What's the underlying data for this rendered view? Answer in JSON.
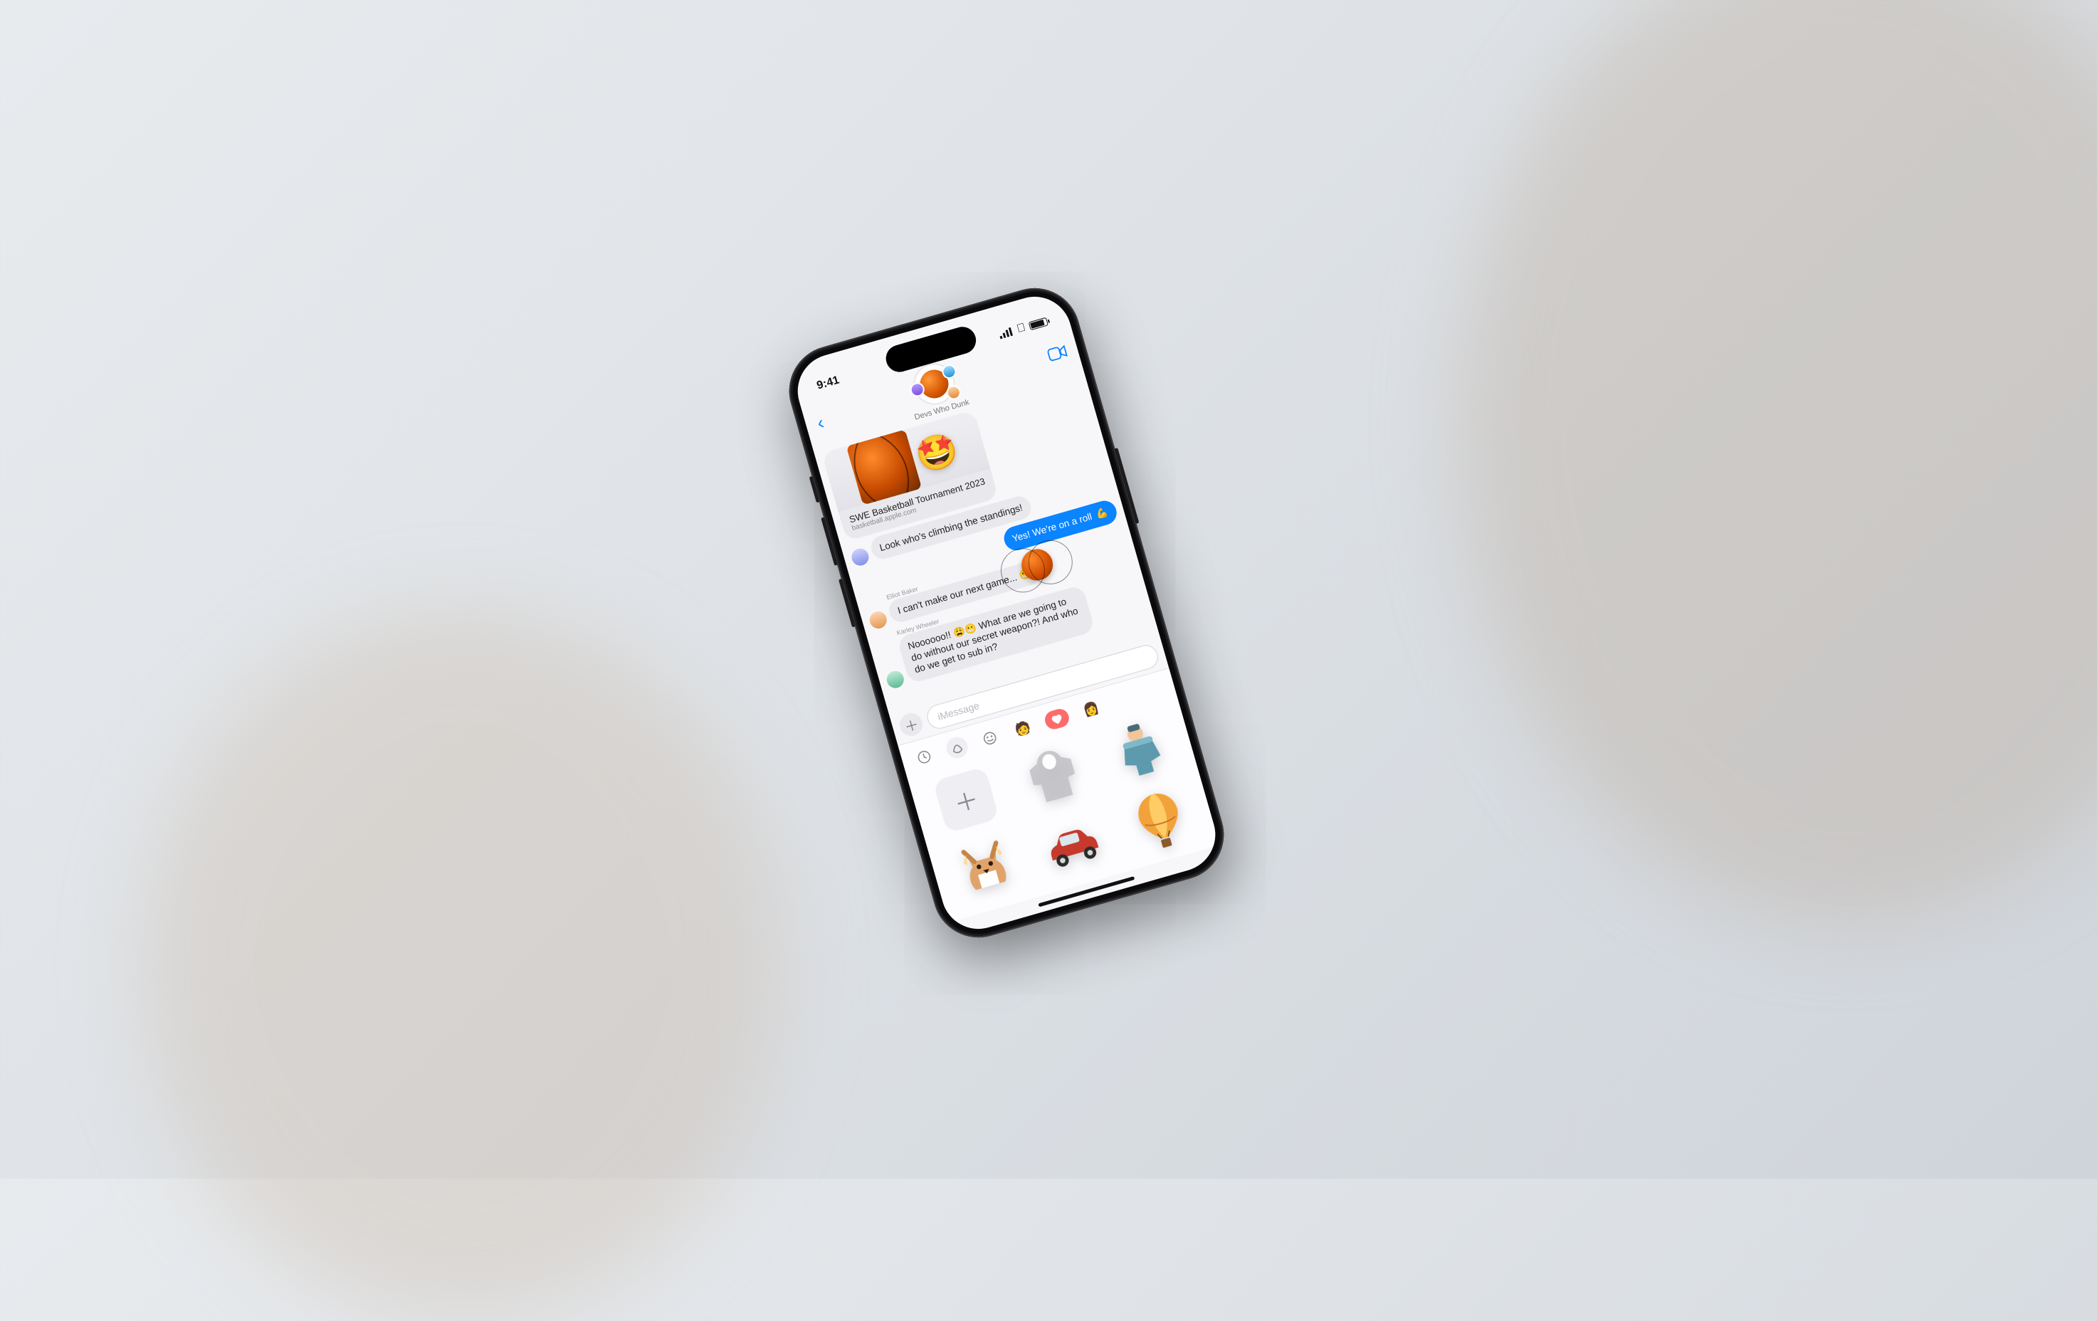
{
  "status": {
    "time": "9:41"
  },
  "header": {
    "group_name": "Devs Who Dunk",
    "back_icon": "chevron-left",
    "facetime_icon": "video-camera"
  },
  "link_card": {
    "title": "SWE Basketball Tournament 2023",
    "domain": "basketball.apple.com",
    "overlay_emoji": "🤩"
  },
  "messages": [
    {
      "dir": "in",
      "sender": "",
      "text": "Look who's climbing the standings!"
    },
    {
      "dir": "out",
      "sender": "",
      "text": "Yes! We're on a roll",
      "emoji": "💪"
    },
    {
      "dir": "in",
      "sender": "Elliot Baker",
      "text": "I can't make our next game... 😬",
      "has_sticker": true
    },
    {
      "dir": "in",
      "sender": "Karley Wheeler",
      "text": "Noooooo!! 😩😬 What are we going to do without our secret weapon?! And who do we get to sub in?"
    }
  ],
  "compose": {
    "placeholder": "iMessage",
    "plus_icon": "plus"
  },
  "sticker_tabs": [
    {
      "name": "recents",
      "icon": "clock"
    },
    {
      "name": "cutouts",
      "icon": "scribble",
      "active": true
    },
    {
      "name": "emoji",
      "icon": "smiley"
    },
    {
      "name": "memoji-1",
      "icon": "avatar"
    },
    {
      "name": "hearts",
      "icon": "heart"
    },
    {
      "name": "memoji-2",
      "icon": "avatar"
    }
  ],
  "stickers": [
    {
      "name": "add"
    },
    {
      "name": "hoodie"
    },
    {
      "name": "kid-snowsuit"
    },
    {
      "name": "corgi"
    },
    {
      "name": "red-car"
    },
    {
      "name": "hot-air-balloon"
    }
  ]
}
